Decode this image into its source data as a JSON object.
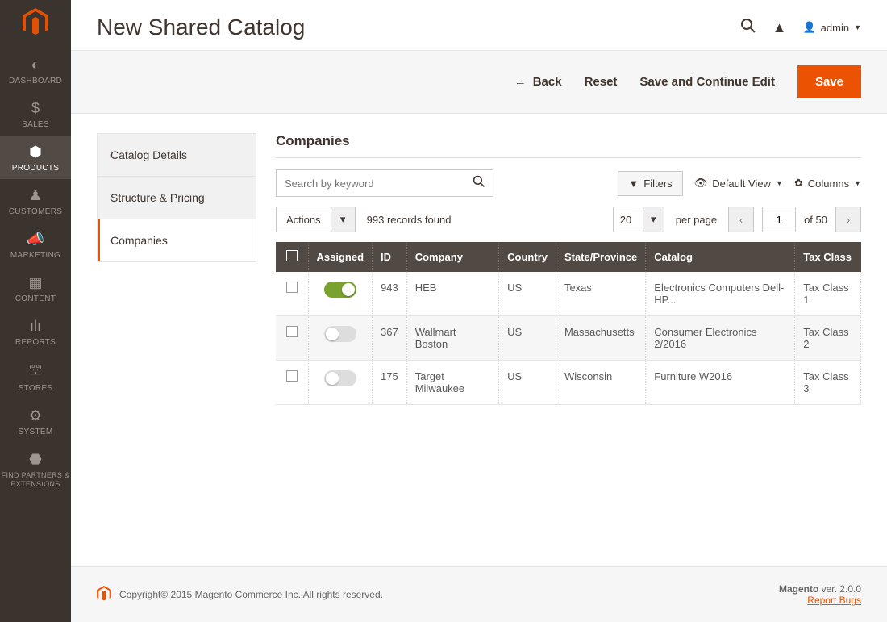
{
  "sidebar": {
    "items": [
      {
        "label": "DASHBOARD"
      },
      {
        "label": "SALES"
      },
      {
        "label": "PRODUCTS"
      },
      {
        "label": "CUSTOMERS"
      },
      {
        "label": "MARKETING"
      },
      {
        "label": "CONTENT"
      },
      {
        "label": "REPORTS"
      },
      {
        "label": "STORES"
      },
      {
        "label": "SYSTEM"
      },
      {
        "label": "FIND PARTNERS & EXTENSIONS"
      }
    ]
  },
  "header": {
    "title": "New Shared Catalog",
    "user": "admin"
  },
  "actions": {
    "back": "Back",
    "reset": "Reset",
    "save_continue": "Save and Continue Edit",
    "save": "Save"
  },
  "tabs": [
    {
      "label": "Catalog Details"
    },
    {
      "label": "Structure & Pricing"
    },
    {
      "label": "Companies"
    }
  ],
  "panel": {
    "title": "Companies",
    "search_placeholder": "Search by keyword",
    "filters": "Filters",
    "default_view": "Default View",
    "columns": "Columns",
    "actions_label": "Actions",
    "records_found": "993 records found",
    "per_page_value": "20",
    "per_page_label": "per page",
    "page_value": "1",
    "page_of": "of 50"
  },
  "table": {
    "headers": [
      "",
      "Assigned",
      "ID",
      "Company",
      "Country",
      "State/Province",
      "Catalog",
      "Tax Class"
    ],
    "rows": [
      {
        "assigned": true,
        "id": "943",
        "company": "HEB",
        "country": "US",
        "state": "Texas",
        "catalog": "Electronics Computers Dell-HP...",
        "tax": "Tax Class 1"
      },
      {
        "assigned": false,
        "id": "367",
        "company": "Wallmart Boston",
        "country": "US",
        "state": "Massachusetts",
        "catalog": "Consumer Electronics 2/2016",
        "tax": "Tax Class 2"
      },
      {
        "assigned": false,
        "id": "175",
        "company": "Target Milwaukee",
        "country": "US",
        "state": "Wisconsin",
        "catalog": "Furniture W2016",
        "tax": "Tax Class 3"
      }
    ]
  },
  "footer": {
    "copyright": "Copyright© 2015 Magento Commerce Inc. All rights reserved.",
    "version_label": "Magento",
    "version": " ver. 2.0.0",
    "report": "Report Bugs"
  }
}
